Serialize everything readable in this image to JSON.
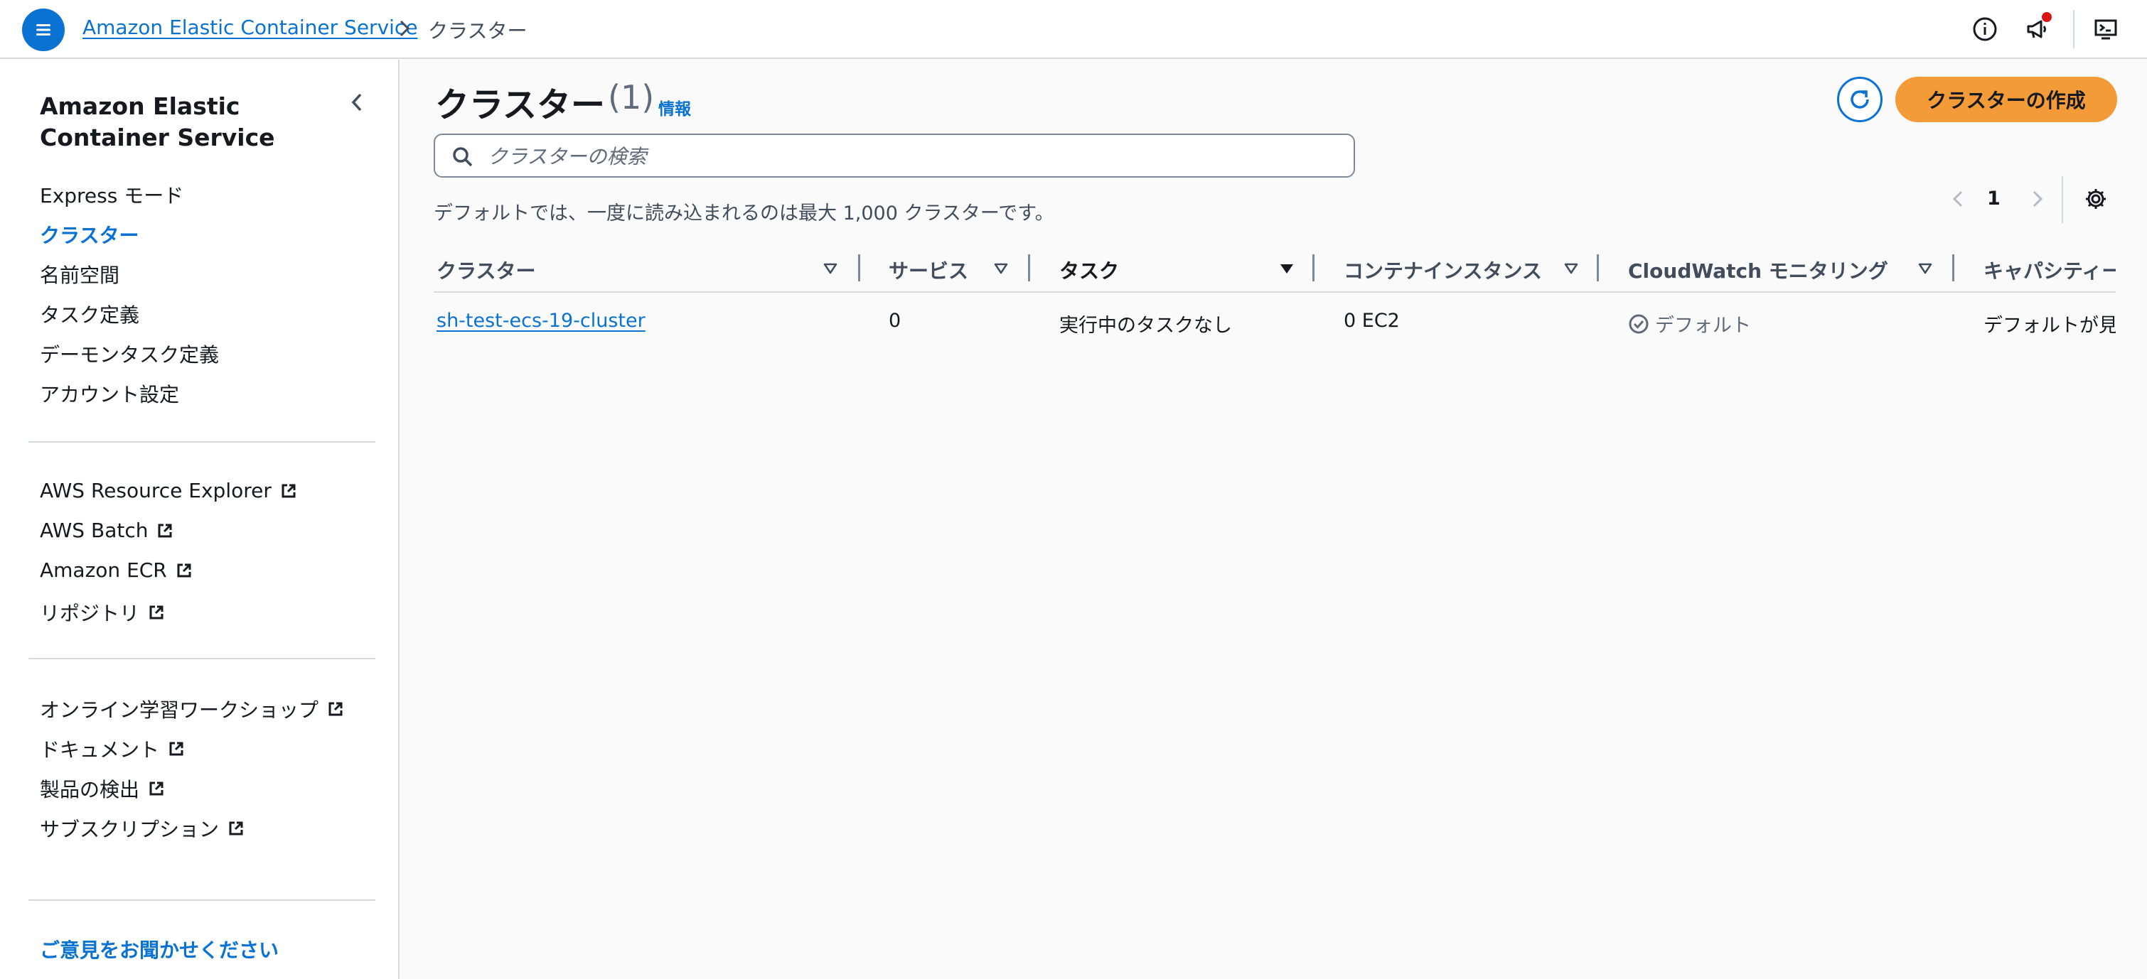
{
  "breadcrumb": {
    "service": "Amazon Elastic Container Service",
    "current": "クラスター"
  },
  "sidebar": {
    "title": "Amazon Elastic Container Service",
    "primary": [
      {
        "label": "Express モード",
        "active": false
      },
      {
        "label": "クラスター",
        "active": true
      },
      {
        "label": "名前空間",
        "active": false
      },
      {
        "label": "タスク定義",
        "active": false
      },
      {
        "label": "デーモンタスク定義",
        "active": false
      },
      {
        "label": "アカウント設定",
        "active": false
      }
    ],
    "related": [
      {
        "label": "AWS Resource Explorer"
      },
      {
        "label": "AWS Batch"
      },
      {
        "label": "Amazon ECR"
      },
      {
        "label": "リポジトリ"
      }
    ],
    "resources": [
      {
        "label": "オンライン学習ワークショップ"
      },
      {
        "label": "ドキュメント"
      },
      {
        "label": "製品の検出"
      },
      {
        "label": "サブスクリプション"
      }
    ],
    "feedback": "ご意見をお聞かせください"
  },
  "main": {
    "title": "クラスター",
    "count": "(1)",
    "info": "情報",
    "create_button": "クラスターの作成",
    "search_placeholder": "クラスターの検索",
    "default_note": "デフォルトでは、一度に読み込まれるのは最大 1,000 クラスターです。",
    "page_number": "1"
  },
  "table": {
    "columns": [
      {
        "label": "クラスター",
        "sorted": false
      },
      {
        "label": "サービス",
        "sorted": false
      },
      {
        "label": "タスク",
        "sorted": true
      },
      {
        "label": "コンテナインスタンス",
        "sorted": false
      },
      {
        "label": "CloudWatch モニタリング",
        "sorted": false
      },
      {
        "label": "キャパシティー",
        "sorted": false
      }
    ],
    "rows": [
      {
        "cluster": "sh-test-ecs-19-cluster",
        "services": "0",
        "tasks": "実行中のタスクなし",
        "container_instances": "0 EC2",
        "cloudwatch": "デフォルト",
        "capacity": "デフォルトが見"
      }
    ]
  },
  "icons": {
    "menu": "menu-icon",
    "info": "info-icon",
    "notifications": "megaphone-icon",
    "cloudshell": "cloudshell-icon",
    "external": "external-link-icon",
    "refresh": "refresh-icon",
    "search": "search-icon",
    "settings": "gear-icon",
    "status_ok": "check-circle-icon"
  },
  "colors": {
    "link": "#0972d3",
    "primary_button": "#f29b38",
    "notification_dot": "#d91515"
  }
}
